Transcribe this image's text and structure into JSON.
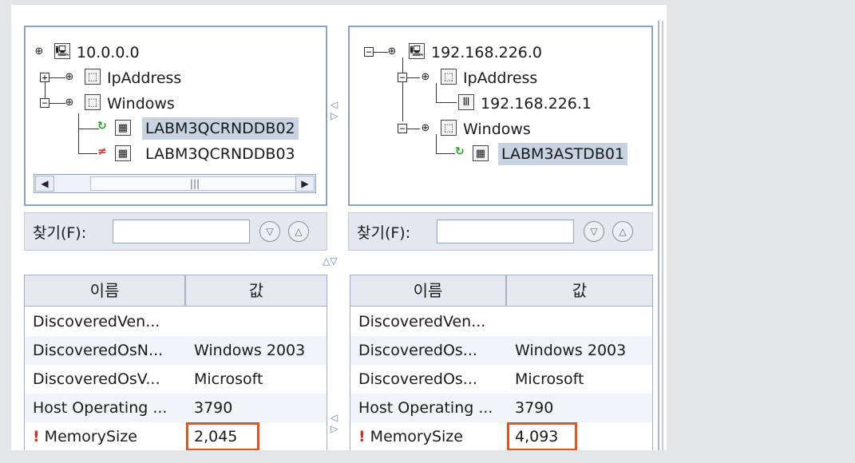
{
  "left": {
    "tree": {
      "root": "10.0.0.0",
      "ip_group": "IpAddress",
      "win_group": "Windows",
      "host1": "LABM3QCRNDDB02",
      "host2": "LABM3QCRNDDB03"
    },
    "find_label": "찾기(F):",
    "find_value": "",
    "props": {
      "header_name": "이름",
      "header_value": "값",
      "rows": [
        {
          "name": "DiscoveredVen...",
          "value": ""
        },
        {
          "name": "DiscoveredOsN...",
          "value": "Windows 2003"
        },
        {
          "name": "DiscoveredOsV...",
          "value": "Microsoft"
        },
        {
          "name": "Host Operating ...",
          "value": "3790"
        },
        {
          "name": "MemorySize",
          "value": "2,045",
          "warning": true
        }
      ]
    }
  },
  "right": {
    "tree": {
      "root": "192.168.226.0",
      "ip_group": "IpAddress",
      "ip_item": "192.168.226.1",
      "win_group": "Windows",
      "host1": "LABM3ASTDB01"
    },
    "find_label": "찾기(F):",
    "find_value": "",
    "props": {
      "header_name": "이름",
      "header_value": "값",
      "rows": [
        {
          "name": "DiscoveredVen...",
          "value": ""
        },
        {
          "name": "DiscoveredOs...",
          "value": "Windows 2003"
        },
        {
          "name": "DiscoveredOs...",
          "value": "Microsoft"
        },
        {
          "name": "Host Operating ...",
          "value": "3790"
        },
        {
          "name": "MemorySize",
          "value": "4,093",
          "warning": true
        }
      ]
    }
  },
  "colors": {
    "highlight": "#e2541d",
    "selection": "#c8d3e2",
    "ok_status": "#2e9a2e",
    "error_status": "#d33333"
  },
  "icons": {
    "expand": "plus-box-icon",
    "collapse": "minus-box-icon",
    "network": "network-computer-icon",
    "ci_group": "cube-icon",
    "host": "windows-host-icon",
    "ip": "ip-address-icon",
    "warning": "exclamation-icon"
  }
}
